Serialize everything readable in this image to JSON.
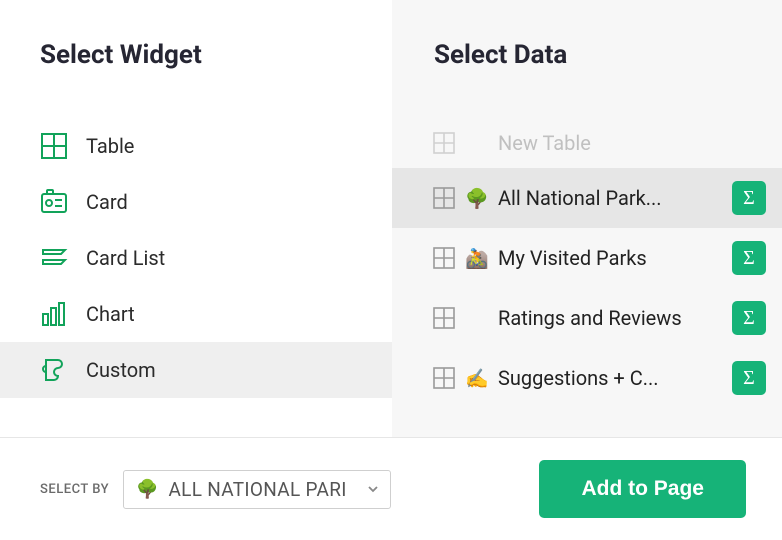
{
  "left": {
    "title": "Select Widget",
    "items": [
      {
        "label": "Table",
        "icon": "table-icon",
        "selected": false
      },
      {
        "label": "Card",
        "icon": "card-icon",
        "selected": false
      },
      {
        "label": "Card List",
        "icon": "cardlist-icon",
        "selected": false
      },
      {
        "label": "Chart",
        "icon": "chart-icon",
        "selected": false
      },
      {
        "label": "Custom",
        "icon": "custom-icon",
        "selected": true
      }
    ]
  },
  "right": {
    "title": "Select Data",
    "items": [
      {
        "label": "New Table",
        "emoji": "",
        "disabled": true,
        "selected": false,
        "sigma": false
      },
      {
        "label": "All National Park...",
        "emoji": "🌳",
        "disabled": false,
        "selected": true,
        "sigma": true
      },
      {
        "label": "My Visited Parks",
        "emoji": "🚵",
        "disabled": false,
        "selected": false,
        "sigma": true
      },
      {
        "label": "Ratings and Reviews",
        "emoji": "",
        "disabled": false,
        "selected": false,
        "sigma": true
      },
      {
        "label": "Suggestions + C...",
        "emoji": "✍️",
        "disabled": false,
        "selected": false,
        "sigma": true
      }
    ]
  },
  "footer": {
    "select_by_label": "SELECT BY",
    "select_by_emoji": "🌳",
    "select_by_value": "ALL NATIONAL PARI",
    "add_button": "Add to Page"
  },
  "sigma_glyph": "Σ",
  "colors": {
    "accent": "#16b378"
  }
}
